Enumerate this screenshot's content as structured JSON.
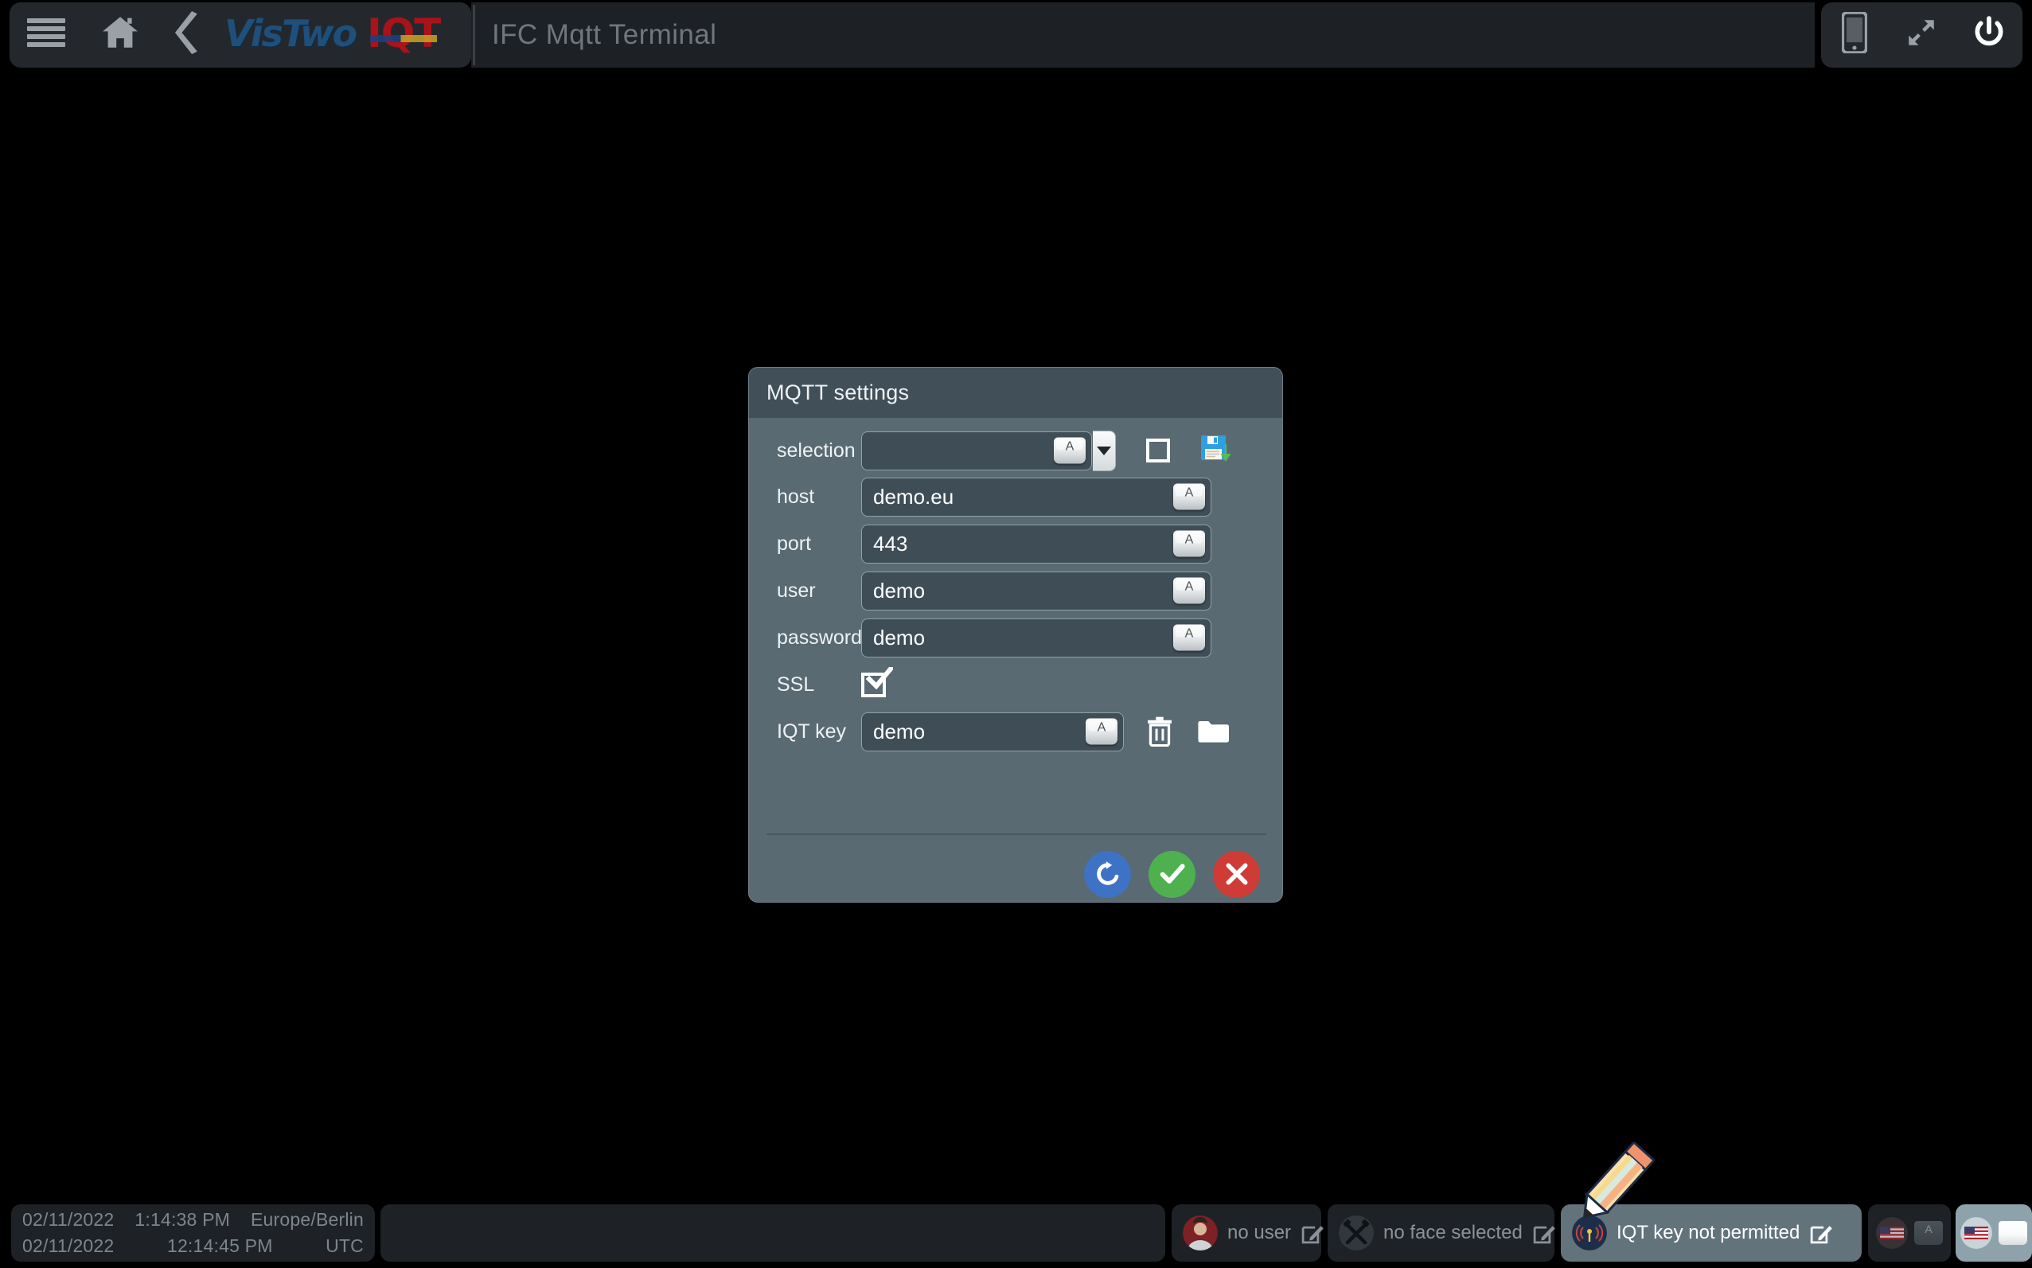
{
  "header": {
    "menu_icon": "hamburger-menu-icon",
    "home_icon": "home-icon",
    "back_icon": "back-chevron-icon",
    "logo_primary": "VisTwo",
    "logo_secondary": "IQT",
    "window_title": "IFC Mqtt Terminal",
    "phone_icon": "mobile-phone-icon",
    "expand_icon": "fullscreen-expand-icon",
    "power_icon": "power-icon",
    "colors": {
      "logo_blue": "#1f4f7a",
      "logo_red": "#a81419",
      "bar_bg": "#24282c",
      "title_text": "#6f767d"
    }
  },
  "dialog": {
    "title": "MQTT settings",
    "rows": {
      "selection": {
        "label": "selection",
        "value": "",
        "placeholder": "",
        "dropdown_icon": "chevron-down-icon",
        "keyboard_icon": "keyboard-key-icon",
        "checkbox_checked": false,
        "save_icon": "floppy-save-icon"
      },
      "host": {
        "label": "host",
        "value": "demo.eu",
        "keyboard_icon": "keyboard-key-icon"
      },
      "port": {
        "label": "port",
        "value": "443",
        "keyboard_icon": "keyboard-key-icon"
      },
      "user": {
        "label": "user",
        "value": "demo",
        "keyboard_icon": "keyboard-key-icon"
      },
      "password": {
        "label": "password",
        "value": "demo",
        "keyboard_icon": "keyboard-key-icon"
      },
      "ssl": {
        "label": "SSL",
        "checked": true
      },
      "iqt_key": {
        "label": "IQT key",
        "value": "demo",
        "keyboard_icon": "keyboard-key-icon",
        "delete_icon": "trash-icon",
        "browse_icon": "folder-icon"
      }
    },
    "actions": {
      "reload": "reload-icon",
      "confirm": "checkmark-icon",
      "cancel": "close-x-icon"
    },
    "colors": {
      "panel_bg": "#5a6a72",
      "titlebar_bg": "#414f58",
      "field_bg": "#3f4d56",
      "reload_blue": "#3e72c4",
      "confirm_green": "#4fb04f",
      "cancel_red": "#cf3b35"
    },
    "keycap_letter": "A"
  },
  "statusbar": {
    "clock": {
      "local_date": "02/11/2022",
      "local_time": "1:14:38 PM",
      "local_zone": "Europe/Berlin",
      "utc_date": "02/11/2022",
      "utc_time": "12:14:45 PM",
      "utc_zone": "UTC"
    },
    "user": {
      "label": "no user",
      "avatar_icon": "user-avatar-icon",
      "edit_icon": "edit-pencil-icon"
    },
    "face": {
      "label": "no face selected",
      "icon": "hammers-icon",
      "edit_icon": "edit-pencil-icon"
    },
    "iqt_key": {
      "label": "IQT key not permitted",
      "icon": "iqt-key-badge-icon",
      "edit_icon": "edit-pencil-icon",
      "highlighted": true
    },
    "language_inactive": {
      "flag_icon": "us-flag-icon",
      "keyboard_icon": "keyboard-key-icon"
    },
    "language_active": {
      "flag_icon": "us-flag-icon",
      "keyboard_icon": "keyboard-key-icon"
    }
  },
  "cursor": {
    "icon": "pencil-cursor"
  }
}
